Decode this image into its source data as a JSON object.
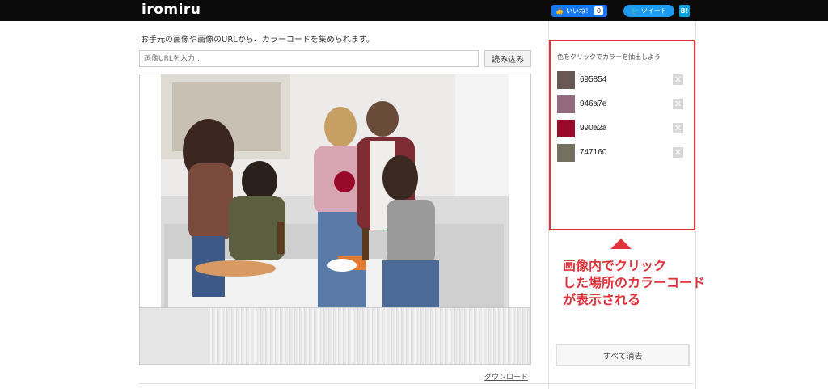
{
  "header": {
    "logo": "iromiru",
    "fb_like": "いいね！",
    "fb_count": "0",
    "tweet": "ツイート",
    "hatena": "B!"
  },
  "main": {
    "intro": "お手元の画像や画像のURLから、カラーコードを集められます。",
    "url_placeholder": "画像URLを入力..",
    "load_button": "読み込み",
    "download_link": "ダウンロード"
  },
  "panel": {
    "title": "色をクリックでカラーを抽出しよう",
    "colors": [
      {
        "hex": "695854",
        "color": "#695854"
      },
      {
        "hex": "946a7e",
        "color": "#946a7e"
      },
      {
        "hex": "990a2a",
        "color": "#990a2a"
      },
      {
        "hex": "747160",
        "color": "#747160"
      }
    ],
    "clear_all": "すべて消去"
  },
  "annotation": {
    "line1": "画像内でクリック",
    "line2": "した場所のカラーコード",
    "line3": "が表示される"
  },
  "icons": {
    "delete": "close-icon",
    "arrow": "arrow-up-icon"
  }
}
